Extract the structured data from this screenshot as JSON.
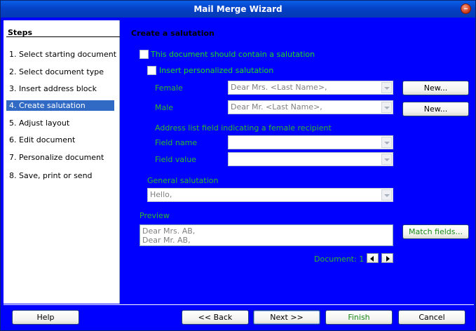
{
  "window": {
    "title": "Mail Merge Wizard"
  },
  "steps": {
    "title": "Steps",
    "items": [
      "1.  Select starting document",
      "2.  Select document type",
      "3.  Insert address block",
      "4.  Create salutation",
      "5.  Adjust layout",
      "6.  Edit document",
      "7.  Personalize document",
      "8.  Save, print or send"
    ],
    "selected_index": 3
  },
  "main": {
    "heading": "Create a salutation",
    "contain_salutation_label": "This document should contain a salutation",
    "insert_personalized_label": "Insert personalized salutation",
    "female_label": "Female",
    "female_value": "Dear Mrs. <Last Name>,",
    "female_new_label": "New...",
    "male_label": "Male",
    "male_value": "Dear Mr. <Last Name>,",
    "male_new_label": "New...",
    "address_field_label": "Address list field indicating a female recipient",
    "field_name_label": "Field name",
    "field_name_value": "",
    "field_value_label": "Field value",
    "field_value_value": "",
    "general_salutation_label": "General salutation",
    "general_salutation_value": "Hello,",
    "preview_label": "Preview",
    "preview_line1": "Dear Mrs. AB,",
    "preview_line2": "Dear Mr. AB,",
    "match_fields_label": "Match fields...",
    "document_label": "Document: 1"
  },
  "footer": {
    "help": "Help",
    "back": "<< Back",
    "next": "Next >>",
    "finish": "Finish",
    "cancel": "Cancel"
  },
  "colors": {
    "background": "#0000ff",
    "label_text": "#1fd81f",
    "selected_step": "#316ac5"
  }
}
